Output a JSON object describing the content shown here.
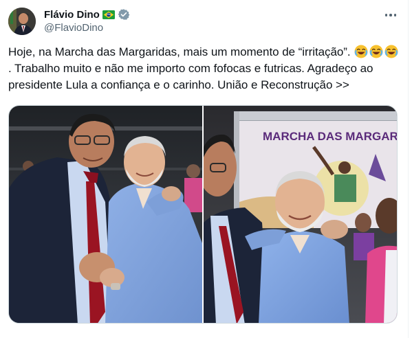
{
  "author": {
    "display_name": "Flávio Dino",
    "handle": "@FlavioDino",
    "flag_icon": "brazil-flag-emoji",
    "verified_icon": "verified-badge-icon",
    "verified_color": "#829aab"
  },
  "tweet": {
    "text_part1": "Hoje, na Marcha das Margaridas, mais um momento de “irritação”. ",
    "text_part2": ". Trabalho muito e não me importo com fofocas e futricas. Agradeço ao presidente Lula a confiança e o carinho. União e Reconstrução >>",
    "emoji": "😂"
  },
  "media": {
    "photo2_banner_text": "MARCHA DAS MARGARI",
    "banner_color": "#5a2a7a"
  },
  "colors": {
    "text": "#0f1419",
    "secondary": "#536471",
    "border": "#cfd9de"
  }
}
